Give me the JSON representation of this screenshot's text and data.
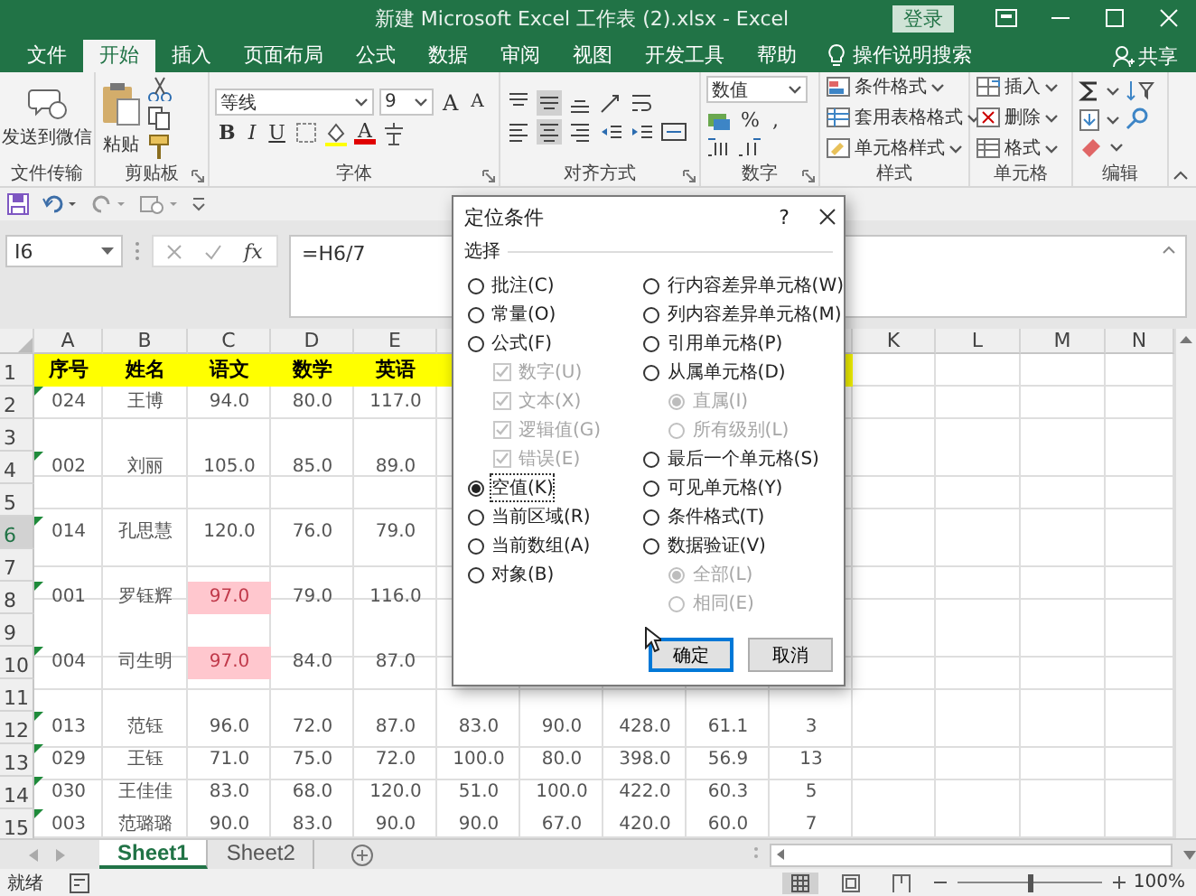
{
  "window": {
    "title": "新建 Microsoft Excel 工作表 (2).xlsx  -  Excel",
    "login": "登录"
  },
  "ribbon_tabs": [
    {
      "label": "文件",
      "selected": false
    },
    {
      "label": "开始",
      "selected": true
    },
    {
      "label": "插入",
      "selected": false
    },
    {
      "label": "页面布局",
      "selected": false
    },
    {
      "label": "公式",
      "selected": false
    },
    {
      "label": "数据",
      "selected": false
    },
    {
      "label": "审阅",
      "selected": false
    },
    {
      "label": "视图",
      "selected": false
    },
    {
      "label": "开发工具",
      "selected": false
    },
    {
      "label": "帮助",
      "selected": false
    }
  ],
  "tell_me": "操作说明搜索",
  "share": "共享",
  "ribbon_groups": [
    {
      "kind": "send",
      "label": "文件传输",
      "button": "发送到微信"
    },
    {
      "kind": "clipboard",
      "label": "剪贴板",
      "button": "粘贴"
    },
    {
      "kind": "font",
      "label": "字体",
      "font": "等线",
      "size": "9",
      "size_buttons": [
        "A",
        "A"
      ],
      "style_buttons": [
        "B",
        "I",
        "U"
      ],
      "color_button": "A"
    },
    {
      "kind": "alignment",
      "label": "对齐方式"
    },
    {
      "kind": "number",
      "label": "数字",
      "format": "数值",
      "symbols": [
        "%",
        ","
      ]
    },
    {
      "kind": "styles",
      "label": "样式",
      "items": [
        "条件格式",
        "套用表格格式",
        "单元格样式"
      ]
    },
    {
      "kind": "cells",
      "label": "单元格",
      "items": [
        "插入",
        "删除",
        "格式"
      ]
    },
    {
      "kind": "editing",
      "label": "编辑"
    }
  ],
  "formula_bar": {
    "name_box": "I6",
    "fx": "fx",
    "formula": "=H6/7"
  },
  "columns": {
    "left": [
      "A",
      "B",
      "C",
      "D",
      "E"
    ],
    "right": [
      "K",
      "L",
      "M",
      "N"
    ]
  },
  "rows": [
    {
      "number": "1",
      "kind": "header",
      "selected": false,
      "flagged": false,
      "cells": [
        "序号",
        "姓名",
        "语文",
        "数学",
        "英语"
      ]
    },
    {
      "number": "2",
      "kind": "data",
      "selected": false,
      "flagged": true,
      "cells": [
        "024",
        "王博",
        "94.0",
        "80.0",
        "117.0"
      ]
    },
    {
      "number": "3",
      "kind": "data",
      "selected": false,
      "flagged": false
    },
    {
      "number": "4",
      "kind": "data",
      "selected": false,
      "flagged": true,
      "cells": [
        "002",
        "刘丽",
        "105.0",
        "85.0",
        "89.0"
      ]
    },
    {
      "number": "5",
      "kind": "data",
      "selected": false,
      "flagged": false
    },
    {
      "number": "6",
      "kind": "data",
      "selected": true,
      "flagged": true,
      "cells": [
        "014",
        "孔思慧",
        "120.0",
        "76.0",
        "79.0"
      ]
    },
    {
      "number": "7",
      "kind": "data",
      "selected": false,
      "flagged": false
    },
    {
      "number": "8",
      "kind": "data",
      "selected": false,
      "flagged": true,
      "cells": [
        "001",
        "罗钰辉",
        {
          "text": "97.0",
          "highlighted": true
        },
        "79.0",
        "116.0"
      ]
    },
    {
      "number": "9",
      "kind": "data",
      "selected": false,
      "flagged": false
    },
    {
      "number": "10",
      "kind": "data",
      "selected": false,
      "flagged": true,
      "cells": [
        "004",
        "司生明",
        {
          "text": "97.0",
          "highlighted": true
        },
        "84.0",
        "87.0"
      ]
    },
    {
      "number": "11",
      "kind": "data",
      "selected": false,
      "flagged": false
    },
    {
      "number": "12",
      "kind": "data",
      "selected": false,
      "flagged": true,
      "cells": [
        "013",
        "范钰",
        "96.0",
        "72.0",
        "87.0",
        "83.0",
        "90.0",
        "428.0",
        "61.1",
        "3"
      ]
    },
    {
      "number": "13",
      "kind": "data",
      "selected": false,
      "flagged": true,
      "cells": [
        "029",
        "王钰",
        "71.0",
        "75.0",
        "72.0",
        "100.0",
        "80.0",
        "398.0",
        "56.9",
        "13"
      ]
    },
    {
      "number": "14",
      "kind": "data",
      "selected": false,
      "flagged": true,
      "cells": [
        "030",
        "王佳佳",
        "83.0",
        "68.0",
        "120.0",
        "51.0",
        "100.0",
        "422.0",
        "60.3",
        "5"
      ]
    },
    {
      "number": "15",
      "kind": "data",
      "selected": false,
      "flagged": true,
      "cells": [
        "003",
        "范璐璐",
        "90.0",
        "83.0",
        "90.0",
        "90.0",
        "67.0",
        "420.0",
        "60.0",
        "7"
      ]
    }
  ],
  "dialog": {
    "title": "定位条件",
    "help": "?",
    "group_label": "选择",
    "left_options": [
      {
        "kind": "radio",
        "label": "批注(C)",
        "selected": false,
        "disabled": false
      },
      {
        "kind": "radio",
        "label": "常量(O)",
        "selected": false,
        "disabled": false
      },
      {
        "kind": "radio",
        "label": "公式(F)",
        "selected": false,
        "disabled": false,
        "children": [
          {
            "kind": "checkbox",
            "label": "数字(U)",
            "checked": true,
            "disabled": true
          },
          {
            "kind": "checkbox",
            "label": "文本(X)",
            "checked": true,
            "disabled": true
          },
          {
            "kind": "checkbox",
            "label": "逻辑值(G)",
            "checked": true,
            "disabled": true
          },
          {
            "kind": "checkbox",
            "label": "错误(E)",
            "checked": true,
            "disabled": true
          }
        ]
      },
      {
        "kind": "radio",
        "label": "空值(K)",
        "selected": true,
        "disabled": false
      },
      {
        "kind": "radio",
        "label": "当前区域(R)",
        "selected": false,
        "disabled": false
      },
      {
        "kind": "radio",
        "label": "当前数组(A)",
        "selected": false,
        "disabled": false
      },
      {
        "kind": "radio",
        "label": "对象(B)",
        "selected": false,
        "disabled": false
      }
    ],
    "right_options": [
      {
        "kind": "radio",
        "label": "行内容差异单元格(W)",
        "selected": false,
        "disabled": false
      },
      {
        "kind": "radio",
        "label": "列内容差异单元格(M)",
        "selected": false,
        "disabled": false
      },
      {
        "kind": "radio",
        "label": "引用单元格(P)",
        "selected": false,
        "disabled": false
      },
      {
        "kind": "radio",
        "label": "从属单元格(D)",
        "selected": false,
        "disabled": false,
        "children": [
          {
            "kind": "radio",
            "label": "直属(I)",
            "selected": true,
            "disabled": true
          },
          {
            "kind": "radio",
            "label": "所有级别(L)",
            "selected": false,
            "disabled": true
          }
        ]
      },
      {
        "kind": "radio",
        "label": "最后一个单元格(S)",
        "selected": false,
        "disabled": false
      },
      {
        "kind": "radio",
        "label": "可见单元格(Y)",
        "selected": false,
        "disabled": false
      },
      {
        "kind": "radio",
        "label": "条件格式(T)",
        "selected": false,
        "disabled": false
      },
      {
        "kind": "radio",
        "label": "数据验证(V)",
        "selected": false,
        "disabled": false,
        "children": [
          {
            "kind": "radio",
            "label": "全部(L)",
            "selected": true,
            "disabled": true
          },
          {
            "kind": "radio",
            "label": "相同(E)",
            "selected": false,
            "disabled": true
          }
        ]
      }
    ],
    "buttons": [
      {
        "label": "确定",
        "default": true
      },
      {
        "label": "取消",
        "default": false
      }
    ]
  },
  "sheet_tabs": [
    {
      "label": "Sheet1",
      "selected": true
    },
    {
      "label": "Sheet2",
      "selected": false
    }
  ],
  "status_bar": {
    "status": "就绪",
    "zoom_slider": {
      "level": 0.5
    },
    "zoom": "100%"
  }
}
